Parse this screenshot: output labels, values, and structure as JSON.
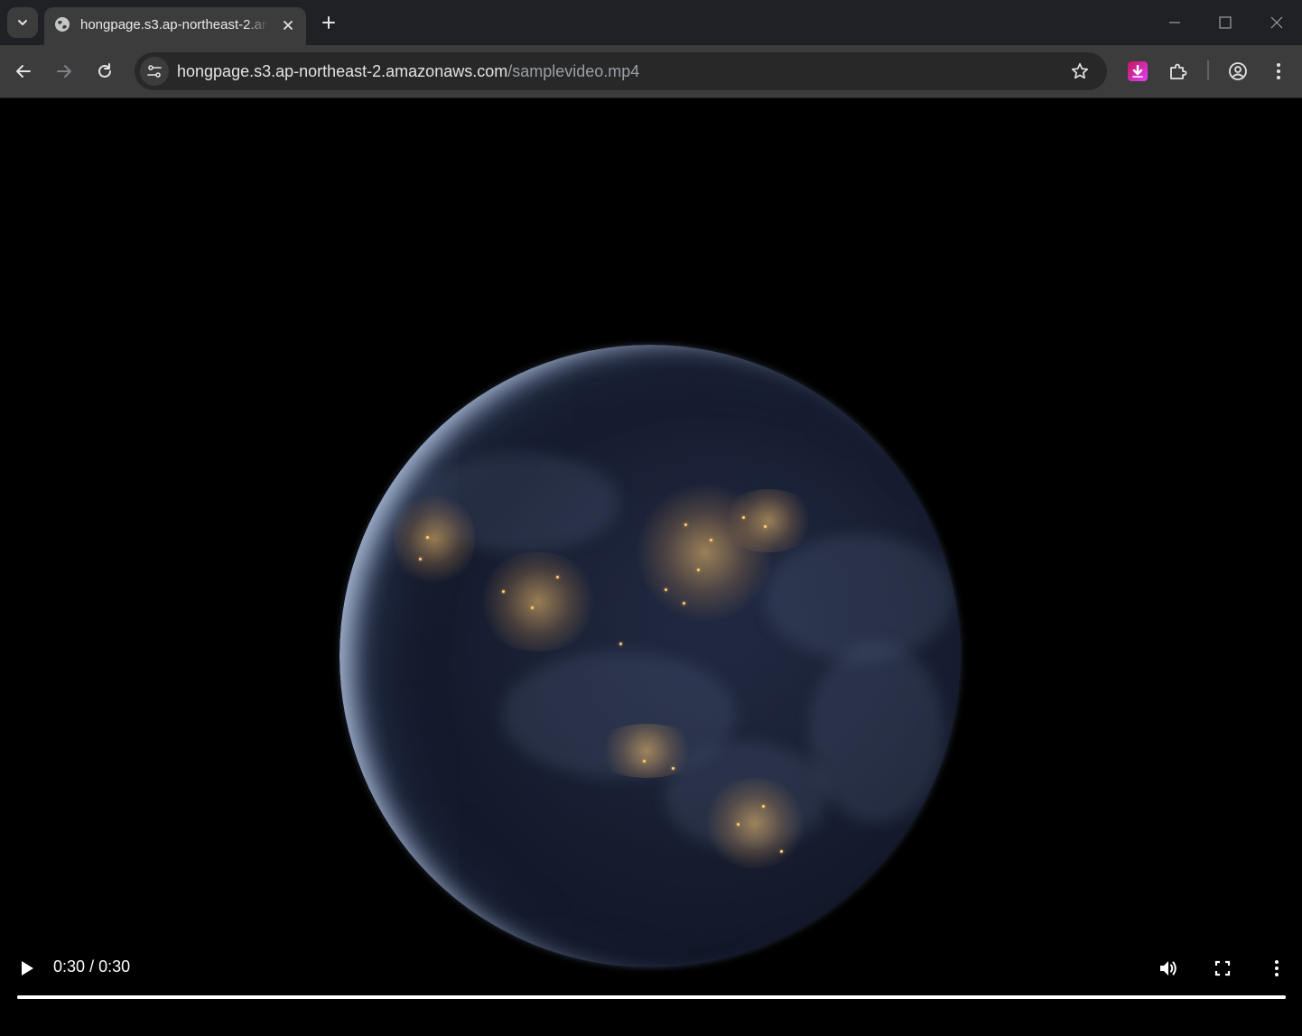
{
  "tab": {
    "title": "hongpage.s3.ap-northeast-2.amazonaws.com/samplevideo.mp4"
  },
  "address_bar": {
    "host": "hongpage.s3.ap-northeast-2.amazonaws.com",
    "path": "/samplevideo.mp4"
  },
  "video": {
    "current_time": "0:30",
    "separator": "/",
    "duration": "0:30",
    "progress": 1.0
  },
  "icons": {
    "tab_search": "chevron-down-icon",
    "favicon": "globe-icon",
    "tab_close": "close-icon",
    "new_tab": "plus-icon",
    "minimize": "minimize-icon",
    "maximize": "maximize-icon",
    "window_close": "close-icon",
    "back": "back-arrow-icon",
    "forward": "forward-arrow-icon",
    "reload": "reload-icon",
    "site_info": "tune-icon",
    "bookmark": "star-icon",
    "extension_download": "download-icon",
    "extensions": "puzzle-icon",
    "profile": "profile-icon",
    "menu": "kebab-menu-icon",
    "play": "play-icon",
    "volume": "volume-icon",
    "fullscreen": "fullscreen-icon",
    "video_menu": "kebab-menu-icon"
  },
  "colors": {
    "tabstrip_bg": "#202124",
    "toolbar_bg": "#3c3c3c",
    "omnibox_bg": "#282828",
    "video_bg": "#000000",
    "extension_accent": "#e040fb"
  }
}
